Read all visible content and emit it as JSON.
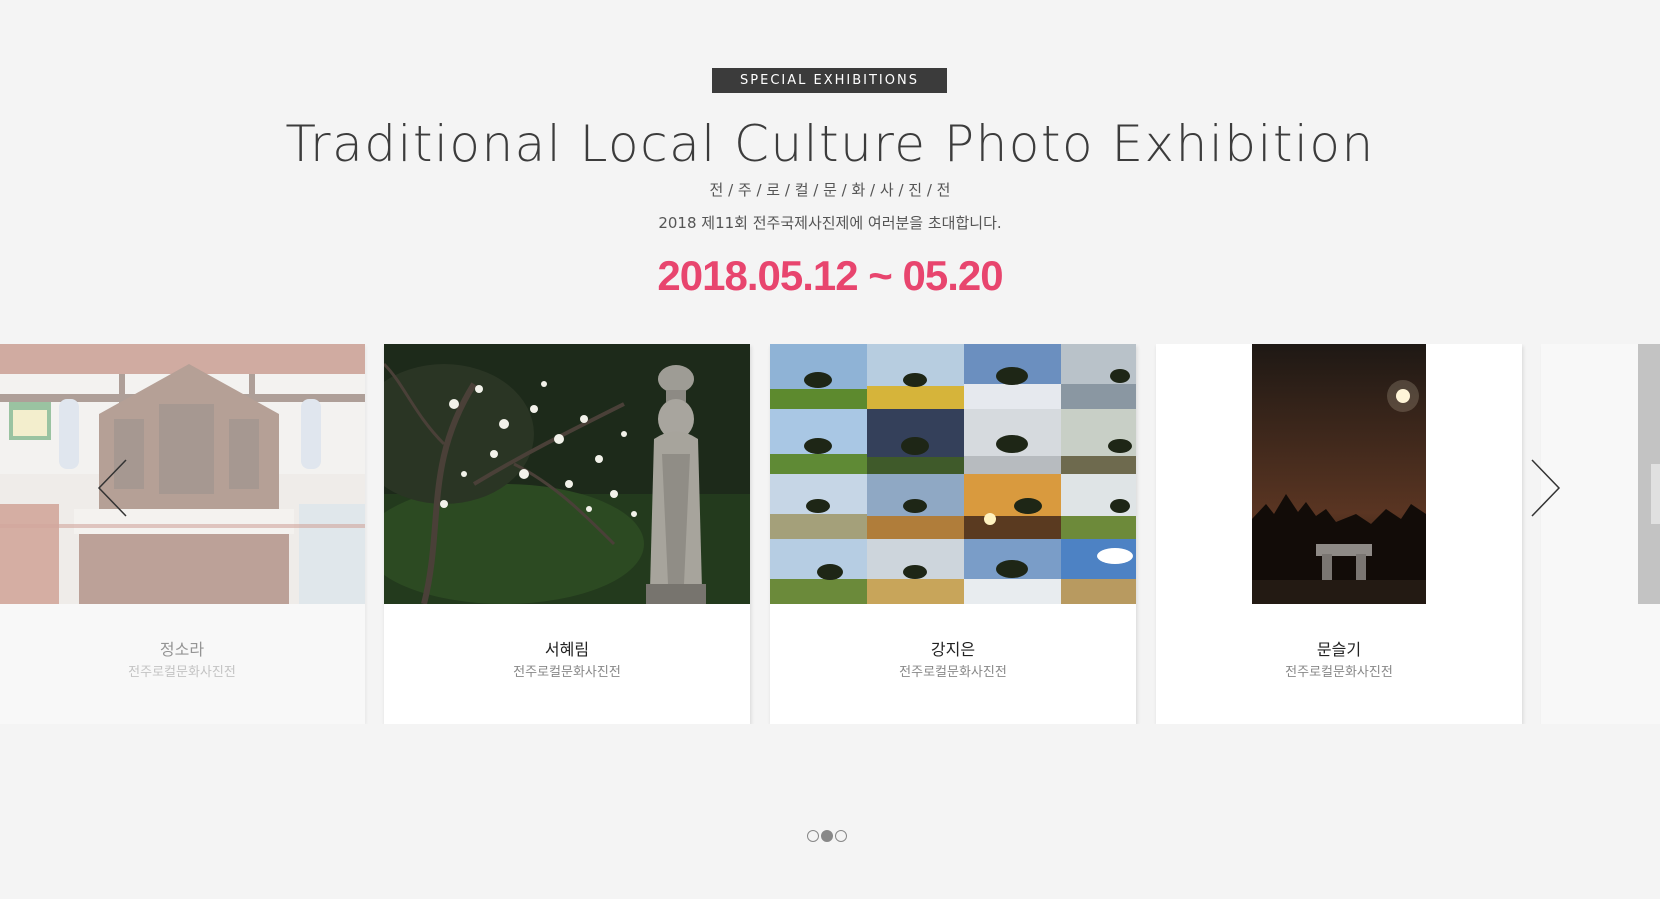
{
  "header": {
    "badge": "SPECIAL EXHIBITIONS",
    "title": "Traditional Local Culture Photo Exhibition",
    "subtitle": "전 / 주 / 로 / 컬 / 문 / 화 / 사 / 진 / 전",
    "invite": "2018 제11회 전주국제사진제에 여러분을 초대합니다.",
    "dates": "2018.05.12 ~ 05.20"
  },
  "colors": {
    "background": "#f4f4f4",
    "badge": "#3b3b3b",
    "date_accent": "#e8456e"
  },
  "carousel": {
    "cards": [
      {
        "name": "정소라",
        "subtitle": "전주로컬문화사진전",
        "image": "church-altar-interior",
        "state": "inactive"
      },
      {
        "name": "서혜림",
        "subtitle": "전주로컬문화사진전",
        "image": "buddha-statue-with-blossoming-tree",
        "state": "active"
      },
      {
        "name": "강지은",
        "subtitle": "전주로컬문화사진전",
        "image": "tree-in-fields-grid-of-16",
        "state": "active"
      },
      {
        "name": "문슬기",
        "subtitle": "전주로컬문화사진전",
        "image": "dolmen-under-moon-at-night",
        "state": "active"
      }
    ],
    "prev_icon": "chevron-left-icon",
    "next_icon": "chevron-right-icon",
    "pagination": {
      "total": 3,
      "active": 2
    }
  }
}
